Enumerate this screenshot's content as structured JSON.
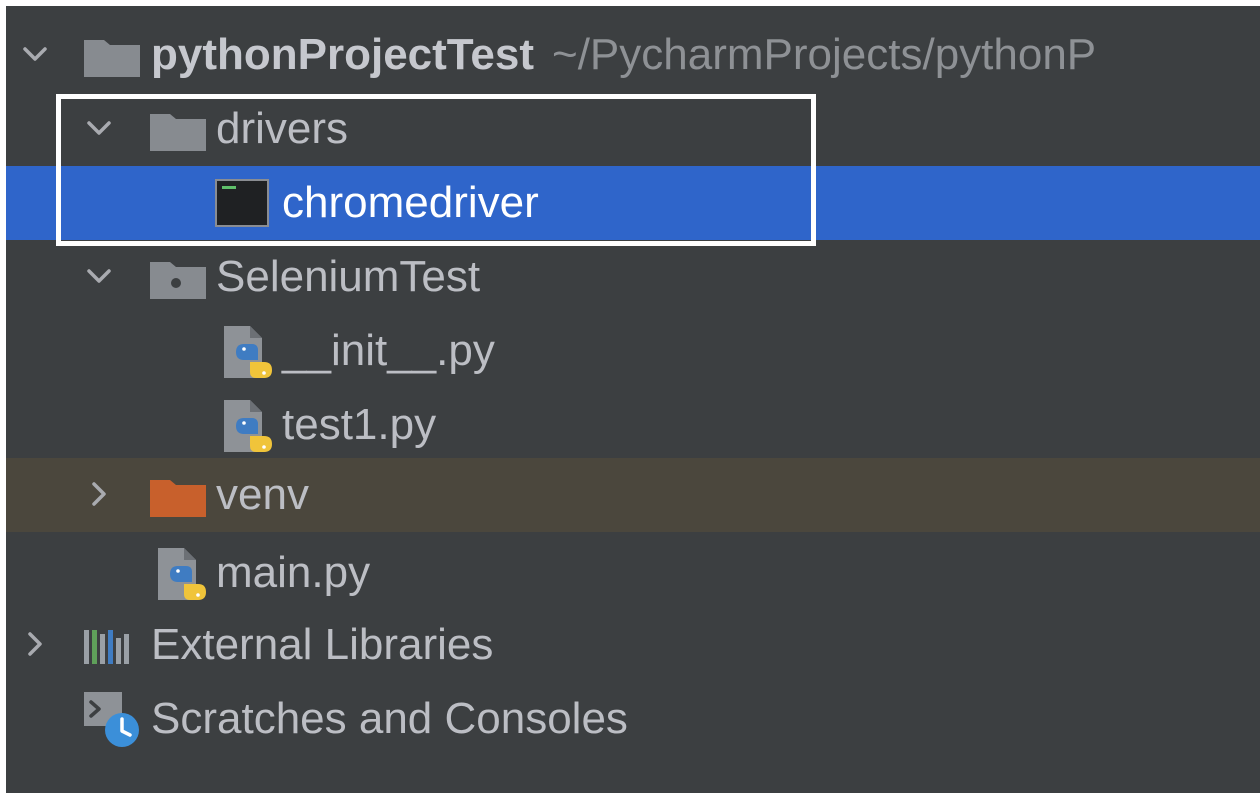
{
  "project_tree": {
    "root": {
      "name": "pythonProjectTest",
      "path": "~/PycharmProjects/pythonP",
      "icon": "folder-icon",
      "expanded": true
    },
    "items": [
      {
        "label": "drivers",
        "icon": "folder-icon",
        "expanded": true
      },
      {
        "label": "chromedriver",
        "icon": "executable-icon",
        "selected": true
      },
      {
        "label": "SeleniumTest",
        "icon": "python-package-icon",
        "expanded": true
      },
      {
        "label": "__init__.py",
        "icon": "python-file-icon"
      },
      {
        "label": "test1.py",
        "icon": "python-file-icon"
      },
      {
        "label": "venv",
        "icon": "excluded-folder-icon",
        "expanded": false,
        "excluded": true
      },
      {
        "label": "main.py",
        "icon": "python-file-icon"
      },
      {
        "label": "External Libraries",
        "icon": "libraries-icon",
        "expanded": false
      },
      {
        "label": "Scratches and Consoles",
        "icon": "scratches-icon"
      }
    ]
  },
  "colors": {
    "panel_background": "#3c3f41",
    "selection": "#2f65ca",
    "excluded_row": "#4b473d",
    "excluded_folder": "#c8602c",
    "highlight_border": "#ffffff"
  }
}
